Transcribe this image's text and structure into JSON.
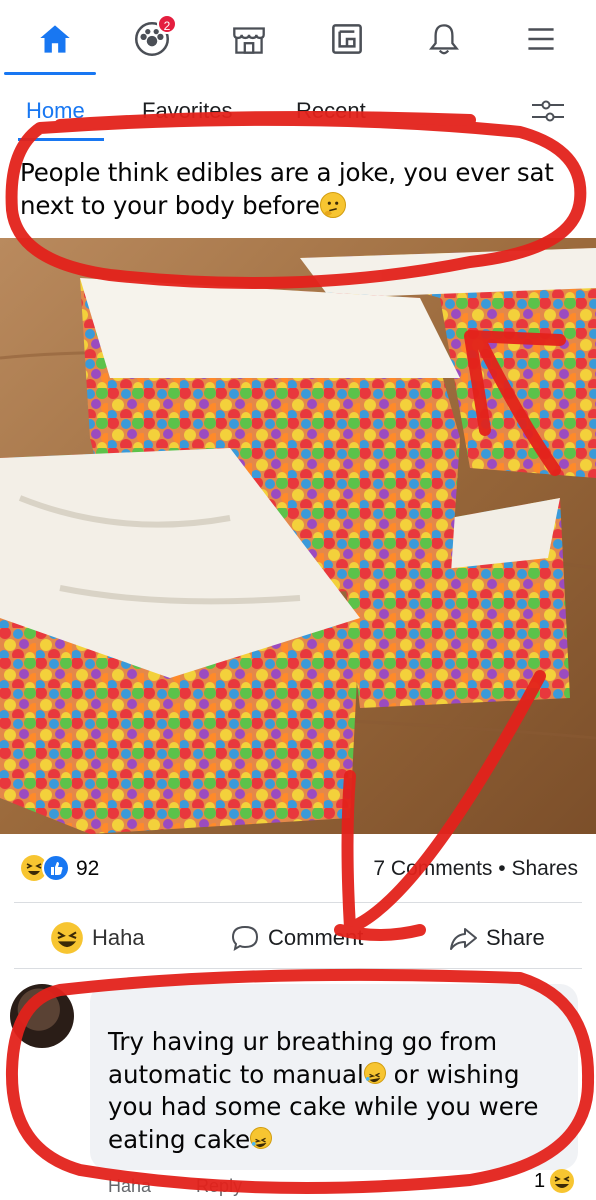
{
  "nav": {
    "items": [
      {
        "name": "home",
        "active": true
      },
      {
        "name": "groups",
        "badge": "2"
      },
      {
        "name": "marketplace"
      },
      {
        "name": "gaming"
      },
      {
        "name": "notifications"
      },
      {
        "name": "menu"
      }
    ],
    "accent": "#1877f2",
    "badge_color": "#e41e3f"
  },
  "feed_tabs": {
    "home": "Home",
    "favorites": "Favorites",
    "recent": "Recent"
  },
  "post": {
    "text": "People think edibles are a joke, you ever sat next to your body before",
    "text_emoji": "thinking-face",
    "image_description_icon": "rainbow-cereal-bars-photo",
    "reaction_count": "92",
    "comments_shares": "7 Comments • Shares",
    "actions": {
      "haha": "Haha",
      "comment": "Comment",
      "share": "Share"
    }
  },
  "comment": {
    "author": "",
    "text_part1": "Try having ur breathing go from automatic to manual",
    "text_part2": " or wishing you had some cake while you were eating cake",
    "footer_react": "Haha",
    "footer_reply": "Reply",
    "reaction_count": "1"
  },
  "annotation_color": "#e3221b"
}
